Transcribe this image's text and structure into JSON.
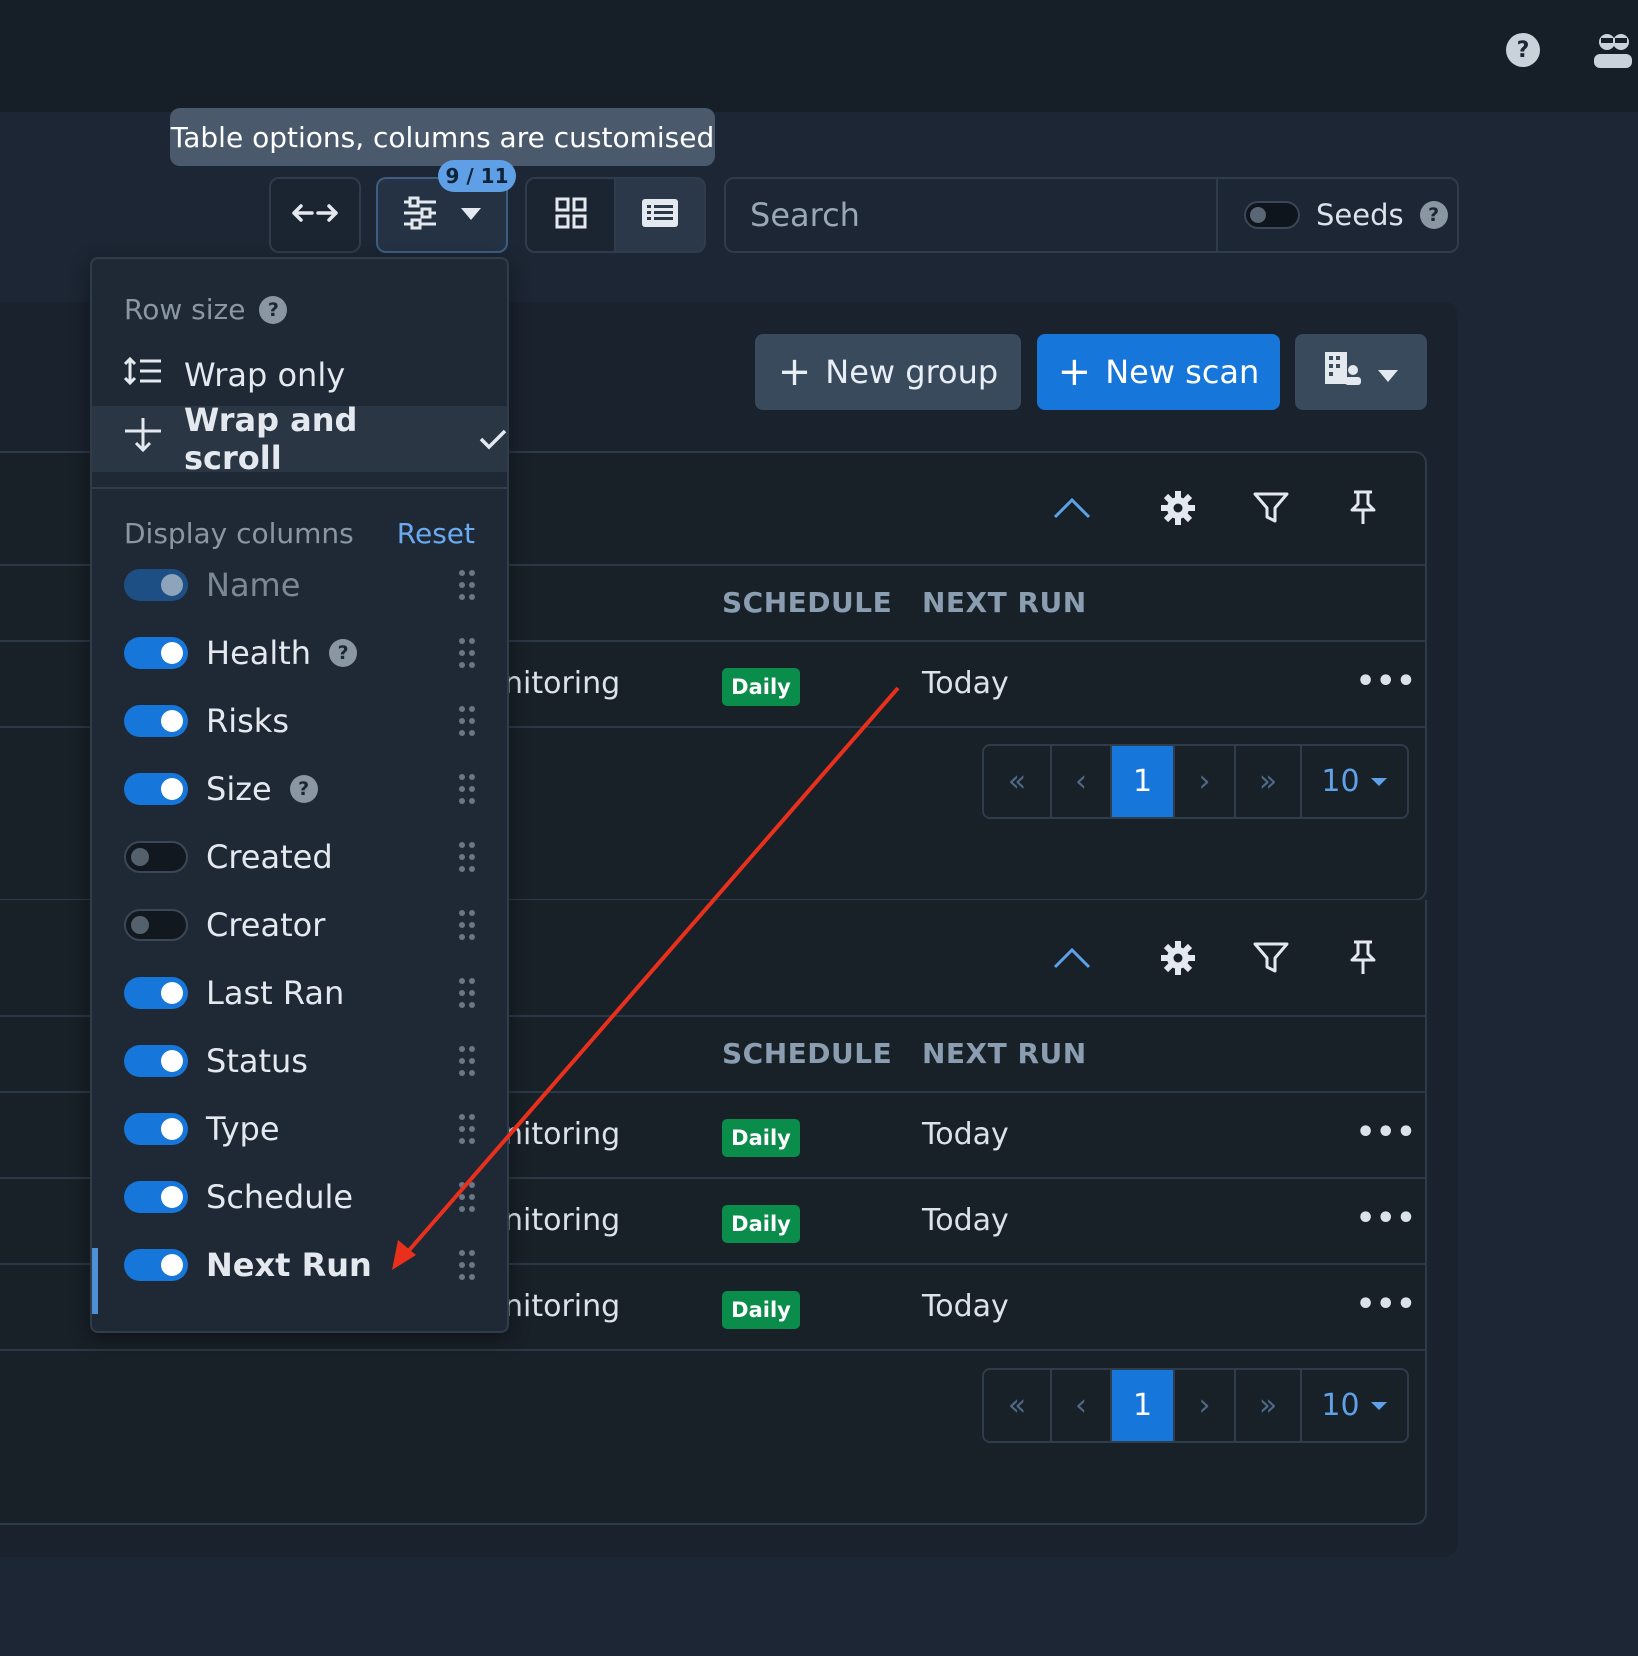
{
  "tooltip": {
    "text": "Table options, columns are customised"
  },
  "toolbar": {
    "column_count_badge": "9 / 11",
    "search_placeholder": "Search",
    "seeds_label": "Seeds"
  },
  "actions": {
    "new_group_label": "New group",
    "new_scan_label": "New scan"
  },
  "menu": {
    "row_size_heading": "Row size",
    "row_size_options": [
      {
        "label": "Wrap only",
        "selected": false
      },
      {
        "label": "Wrap and scroll",
        "selected": true
      }
    ],
    "display_columns_heading": "Display columns",
    "reset_label": "Reset",
    "columns": [
      {
        "label": "Name",
        "state": "disabled-on",
        "help": false
      },
      {
        "label": "Health",
        "state": "on",
        "help": true
      },
      {
        "label": "Risks",
        "state": "on",
        "help": false
      },
      {
        "label": "Size",
        "state": "on",
        "help": true
      },
      {
        "label": "Created",
        "state": "off",
        "help": false
      },
      {
        "label": "Creator",
        "state": "off",
        "help": false
      },
      {
        "label": "Last Ran",
        "state": "on",
        "help": false
      },
      {
        "label": "Status",
        "state": "on",
        "help": false
      },
      {
        "label": "Type",
        "state": "on",
        "help": false
      },
      {
        "label": "Schedule",
        "state": "on",
        "help": false
      },
      {
        "label": "Next Run",
        "state": "on",
        "help": false
      }
    ]
  },
  "tables": [
    {
      "headers": {
        "schedule": "SCHEDULE",
        "next_run": "NEXT RUN"
      },
      "rows": [
        {
          "type_fragment": "nitoring",
          "schedule": "Daily",
          "next_run": "Today"
        }
      ],
      "pager": {
        "first": "«",
        "prev": "‹",
        "page": "1",
        "next": "›",
        "last": "»",
        "page_size": "10"
      }
    },
    {
      "headers": {
        "schedule": "SCHEDULE",
        "next_run": "NEXT RUN"
      },
      "rows": [
        {
          "type_fragment": "nitoring",
          "schedule": "Daily",
          "next_run": "Today"
        },
        {
          "type_fragment": "nitoring",
          "schedule": "Daily",
          "next_run": "Today"
        },
        {
          "type_fragment": "nitoring",
          "schedule": "Daily",
          "next_run": "Today"
        }
      ],
      "pager": {
        "first": "«",
        "prev": "‹",
        "page": "1",
        "next": "›",
        "last": "»",
        "page_size": "10"
      }
    }
  ],
  "colors": {
    "background": "#1c2634",
    "accent": "#1676d9",
    "badge_green": "#0a8c4a",
    "annotation_arrow": "#e8301c"
  }
}
